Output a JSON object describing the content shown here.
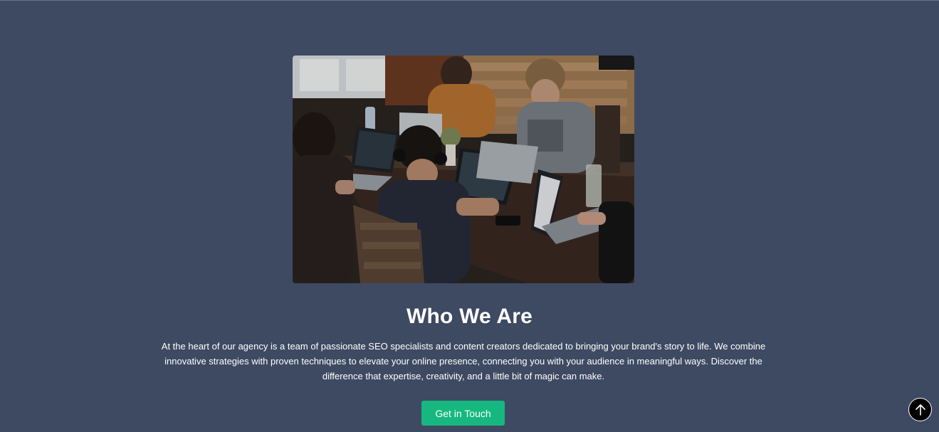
{
  "about": {
    "image_alt": "Team working on laptops around a table",
    "title": "Who We Are",
    "description": "At the heart of our agency is a team of passionate SEO specialists and content creators dedicated to bringing your brand's story to life. We combine innovative strategies with proven techniques to elevate your online presence, connecting you with your audience in meaningful ways. Discover the difference that expertise, creativity, and a little bit of magic can make.",
    "cta_label": "Get in Touch"
  },
  "scroll_top": {
    "icon": "arrow-up-icon"
  },
  "colors": {
    "background": "#3e4a62",
    "accent": "#16b87f",
    "text": "#ffffff"
  }
}
